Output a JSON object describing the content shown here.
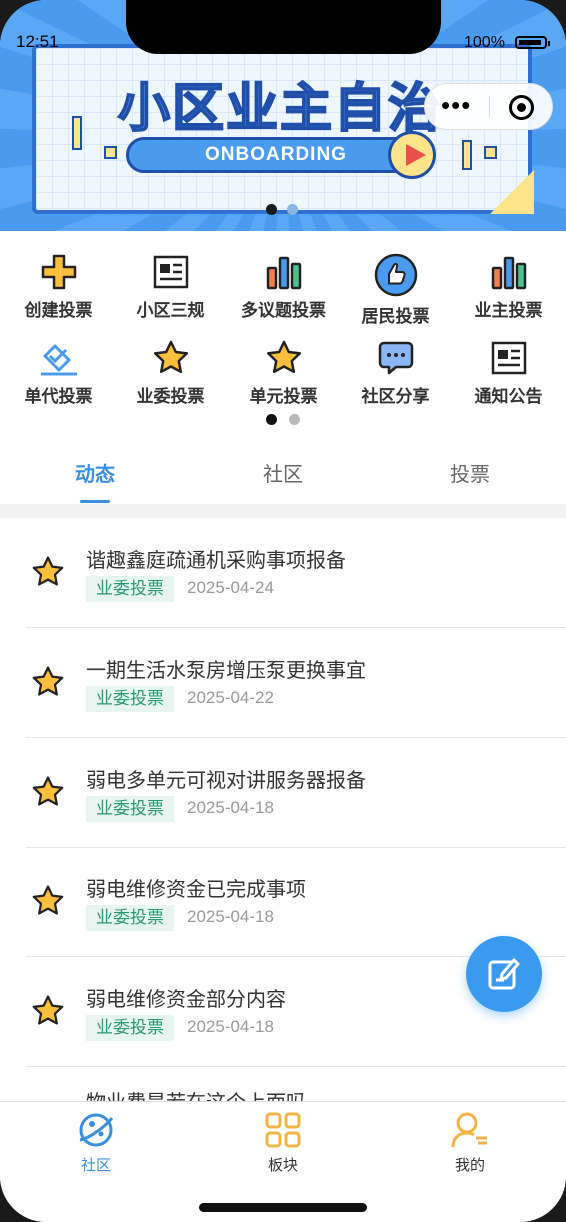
{
  "status_bar": {
    "time": "12:51",
    "battery": "100%"
  },
  "banner": {
    "title": "小区业主自治",
    "button_label": "ONBOARDING",
    "slide_count": 2,
    "active_slide": 1
  },
  "grid": {
    "items": [
      {
        "label": "创建投票",
        "icon": "plus-icon"
      },
      {
        "label": "小区三规",
        "icon": "document-icon"
      },
      {
        "label": "多议题投票",
        "icon": "bar-chart-icon"
      },
      {
        "label": "居民投票",
        "icon": "thumbs-up-icon"
      },
      {
        "label": "业主投票",
        "icon": "bar-chart-icon"
      },
      {
        "label": "单代投票",
        "icon": "check-box-icon"
      },
      {
        "label": "业委投票",
        "icon": "star-icon"
      },
      {
        "label": "单元投票",
        "icon": "star-icon"
      },
      {
        "label": "社区分享",
        "icon": "chat-bubble-icon"
      },
      {
        "label": "通知公告",
        "icon": "document-icon"
      }
    ],
    "page_count": 2,
    "active_page": 1
  },
  "tabs": [
    {
      "label": "动态",
      "active": true
    },
    {
      "label": "社区",
      "active": false
    },
    {
      "label": "投票",
      "active": false
    }
  ],
  "feed": [
    {
      "title": "谐趣鑫庭疏通机采购事项报备",
      "tag": "业委投票",
      "date": "2025-04-24"
    },
    {
      "title": "一期生活水泵房增压泵更换事宜",
      "tag": "业委投票",
      "date": "2025-04-22"
    },
    {
      "title": "弱电多单元可视对讲服务器报备",
      "tag": "业委投票",
      "date": "2025-04-18"
    },
    {
      "title": "弱电维修资金已完成事项",
      "tag": "业委投票",
      "date": "2025-04-18"
    },
    {
      "title": "弱电维修资金部分内容",
      "tag": "业委投票",
      "date": "2025-04-18"
    }
  ],
  "feed_peek_title": "物业费是若在这个上面吗",
  "bottom_nav": [
    {
      "label": "社区",
      "icon": "planet-icon",
      "active": true
    },
    {
      "label": "板块",
      "icon": "grid-icon",
      "active": false
    },
    {
      "label": "我的",
      "icon": "user-icon",
      "active": false
    }
  ],
  "colors": {
    "accent": "#3a8fe0",
    "tag_bg": "#e6f5ef",
    "tag_text": "#2a9a72",
    "icon_yellow": "#fbbf3c"
  }
}
